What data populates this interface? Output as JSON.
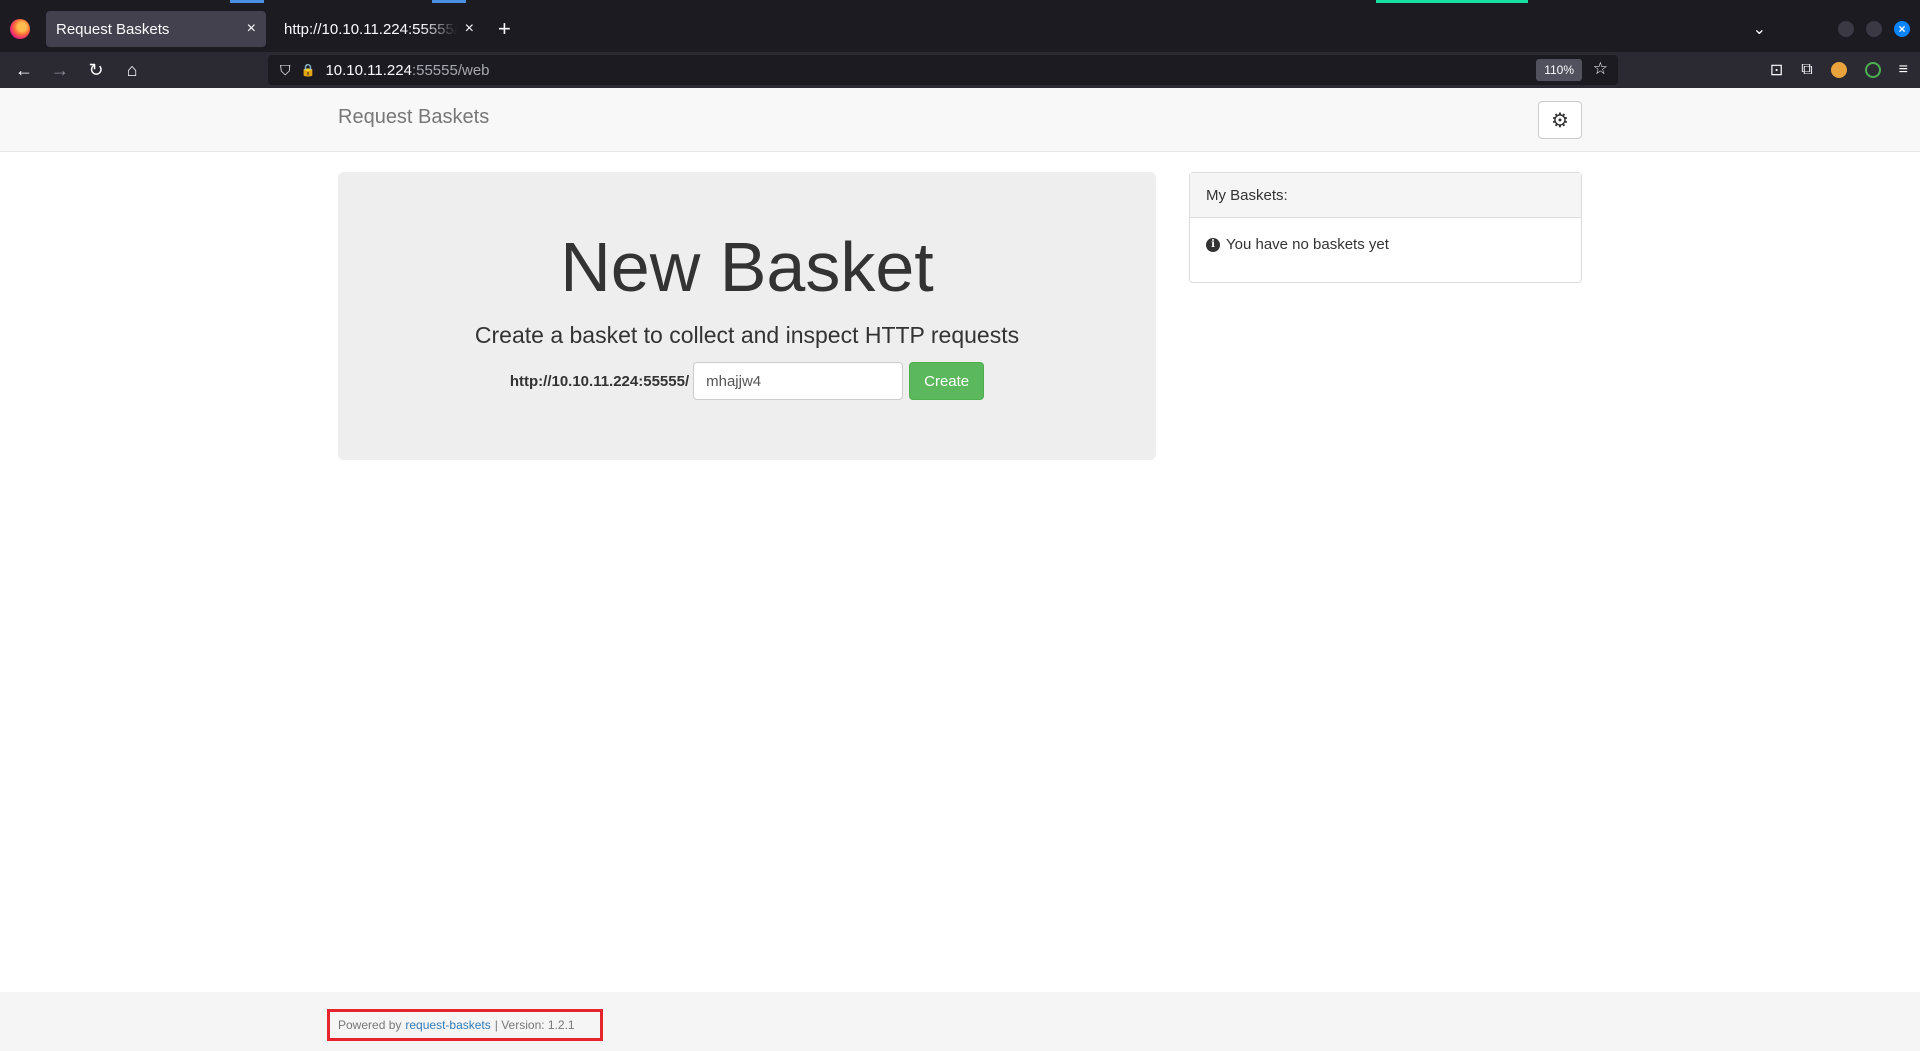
{
  "browser": {
    "tabs": [
      {
        "title": "Request Baskets",
        "active": true
      },
      {
        "title": "http://10.10.11.224:55555/web",
        "active": false
      }
    ],
    "url": {
      "host": "10.10.11.224",
      "path": ":55555/web"
    },
    "zoom": "110%",
    "icons": {
      "back": "←",
      "forward": "→",
      "reload": "↻",
      "home": "⌂",
      "shield": "⛉",
      "lock": "🔒",
      "star": "☆",
      "close": "×",
      "new_tab": "+",
      "chevron": "⌄",
      "pocket": "⊡",
      "extensions": "⧉",
      "menu": "≡"
    }
  },
  "app": {
    "brand": "Request Baskets",
    "settings_icon": "⚙",
    "jumbotron": {
      "title": "New Basket",
      "lead": "Create a basket to collect and inspect HTTP requests",
      "base_url": "http://10.10.11.224:55555/",
      "basket_name": "mhajjw4",
      "create_label": "Create"
    },
    "my_baskets": {
      "heading": "My Baskets:",
      "empty_message": "You have no baskets yet",
      "info_icon": "i"
    },
    "footer": {
      "powered_by": "Powered by",
      "link_text": "request-baskets",
      "version_text": "| Version: 1.2.1"
    }
  }
}
